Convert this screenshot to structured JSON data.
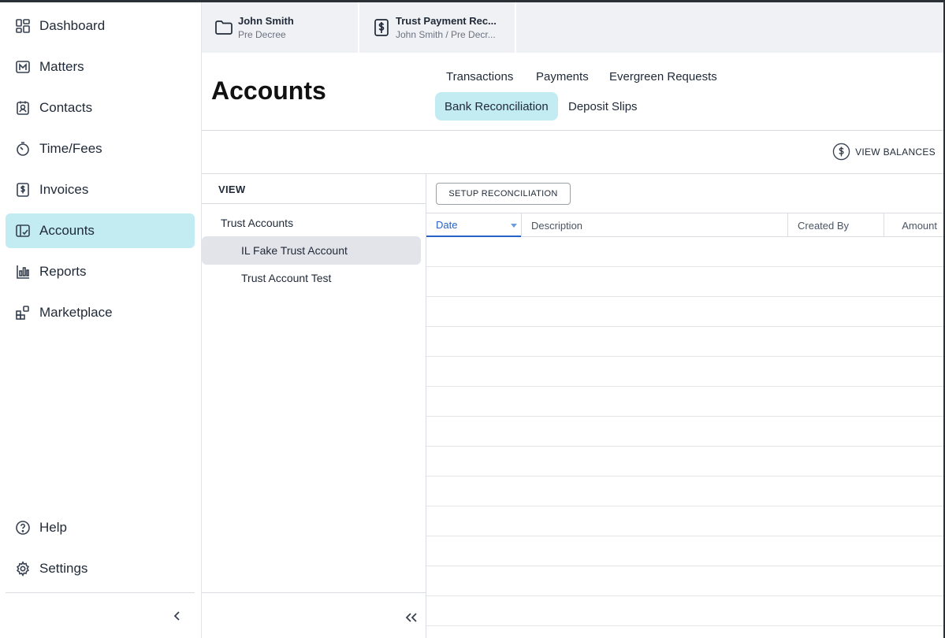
{
  "sidebar": {
    "items": [
      {
        "label": "Dashboard",
        "icon": "dashboard-icon"
      },
      {
        "label": "Matters",
        "icon": "matters-icon"
      },
      {
        "label": "Contacts",
        "icon": "contacts-icon"
      },
      {
        "label": "Time/Fees",
        "icon": "stopwatch-icon"
      },
      {
        "label": "Invoices",
        "icon": "invoice-icon"
      },
      {
        "label": "Accounts",
        "icon": "accounts-icon",
        "active": true
      },
      {
        "label": "Reports",
        "icon": "reports-icon"
      },
      {
        "label": "Marketplace",
        "icon": "marketplace-icon"
      }
    ],
    "bottom_items": [
      {
        "label": "Help",
        "icon": "help-icon"
      },
      {
        "label": "Settings",
        "icon": "gear-icon"
      }
    ],
    "collapse_icon": "chevron-left-icon"
  },
  "tabs": [
    {
      "title": "John Smith",
      "subtitle": "Pre Decree",
      "icon": "folder-icon"
    },
    {
      "title": "Trust Payment Rec...",
      "subtitle": "John Smith / Pre Decr...",
      "icon": "dollar-document-icon"
    }
  ],
  "header": {
    "title": "Accounts",
    "subtabs_row1": [
      "Transactions",
      "Payments",
      "Evergreen Requests"
    ],
    "subtabs_row2": [
      "Bank Reconciliation",
      "Deposit Slips"
    ],
    "active_subtab": "Bank Reconciliation"
  },
  "toolbar": {
    "view_balances_label": "VIEW BALANCES",
    "view_balances_icon": "dollar-circle-icon"
  },
  "account_panel": {
    "view_label": "VIEW",
    "group_label": "Trust Accounts",
    "accounts": [
      "IL Fake Trust Account",
      "Trust Account Test"
    ],
    "selected_account": "IL Fake Trust Account",
    "collapse_icon": "double-chevron-left-icon"
  },
  "grid": {
    "setup_button_label": "SETUP RECONCILIATION",
    "columns": [
      "Date",
      "Description",
      "Created By",
      "Amount"
    ],
    "sorted_column": "Date",
    "rows": []
  },
  "colors": {
    "accent_active": "#c3ebf2",
    "sort_blue": "#2563c9",
    "selected_row": "#e2e4ea",
    "tab_strip": "#f0f1f4"
  }
}
